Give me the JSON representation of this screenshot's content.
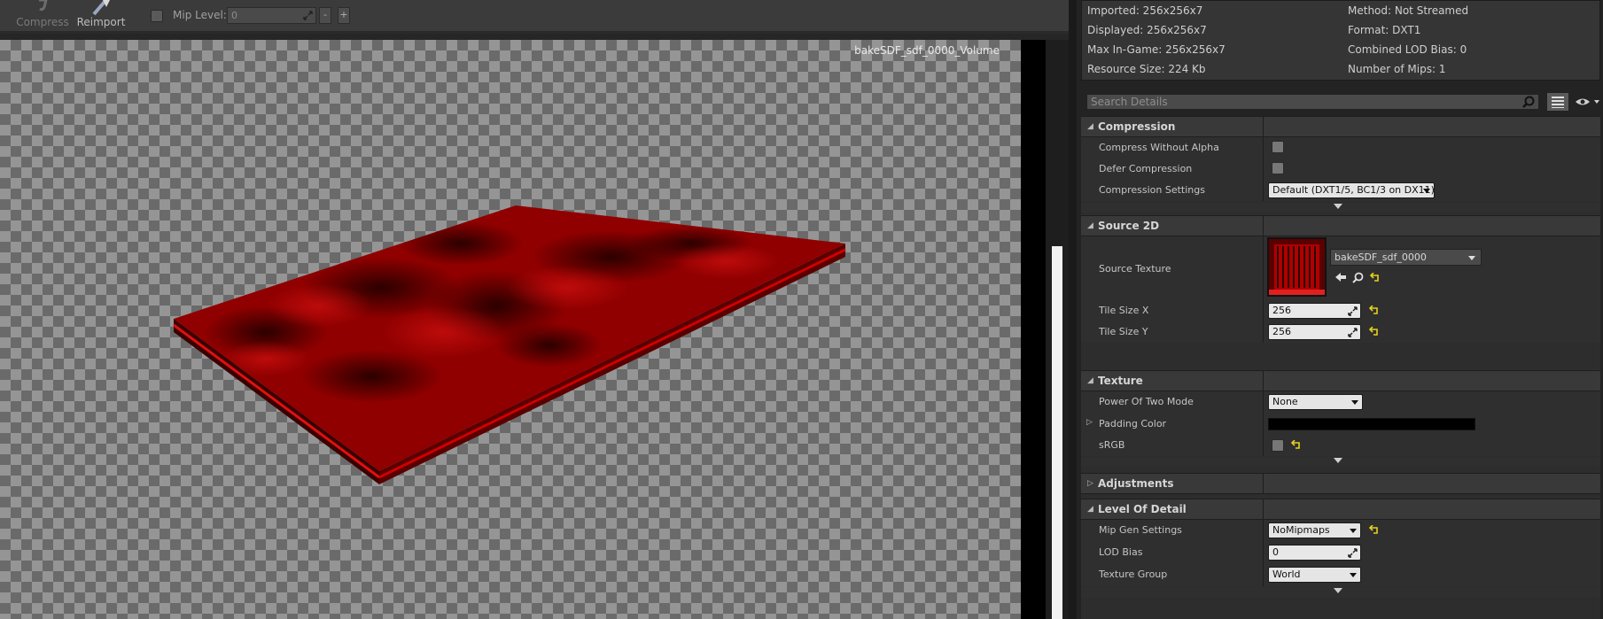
{
  "toolbar": {
    "compress_label": "Compress",
    "reimport_label": "Reimport",
    "mip_label": "Mip Level:",
    "mip_value": "0",
    "minus_label": "-",
    "plus_label": "+"
  },
  "viewport": {
    "title": "bakeSDF_sdf_0000_Volume"
  },
  "info": {
    "imported": "Imported: 256x256x7",
    "displayed": "Displayed: 256x256x7",
    "max_in_game": "Max In-Game: 256x256x7",
    "resource_size": "Resource Size: 224 Kb",
    "method": "Method: Not Streamed",
    "format": "Format: DXT1",
    "combined_lod_bias": "Combined LOD Bias: 0",
    "number_of_mips": "Number of Mips: 1"
  },
  "search": {
    "placeholder": "Search Details"
  },
  "details": {
    "compression": {
      "title": "Compression",
      "compress_without_alpha": "Compress Without Alpha",
      "defer_compression": "Defer Compression",
      "compression_settings": "Compression Settings",
      "compression_settings_value": "Default (DXT1/5, BC1/3 on DX11)"
    },
    "source_2d": {
      "title": "Source 2D",
      "source_texture": "Source Texture",
      "source_texture_value": "bakeSDF_sdf_0000",
      "tile_size_x": "Tile Size X",
      "tile_size_x_value": "256",
      "tile_size_y": "Tile Size Y",
      "tile_size_y_value": "256"
    },
    "texture": {
      "title": "Texture",
      "power_of_two_mode": "Power Of Two Mode",
      "power_of_two_mode_value": "None",
      "padding_color": "Padding Color",
      "srgb": "sRGB"
    },
    "adjustments": {
      "title": "Adjustments"
    },
    "level_of_detail": {
      "title": "Level Of Detail",
      "mip_gen_settings": "Mip Gen Settings",
      "mip_gen_settings_value": "NoMipmaps",
      "lod_bias": "LOD Bias",
      "lod_bias_value": "0",
      "texture_group": "Texture Group",
      "texture_group_value": "World"
    }
  },
  "colors": {
    "panel_bg": "#2d2d2d",
    "category_bg": "#393939",
    "reset_arrow": "#e6d21e",
    "volume_red": "#a00000"
  }
}
